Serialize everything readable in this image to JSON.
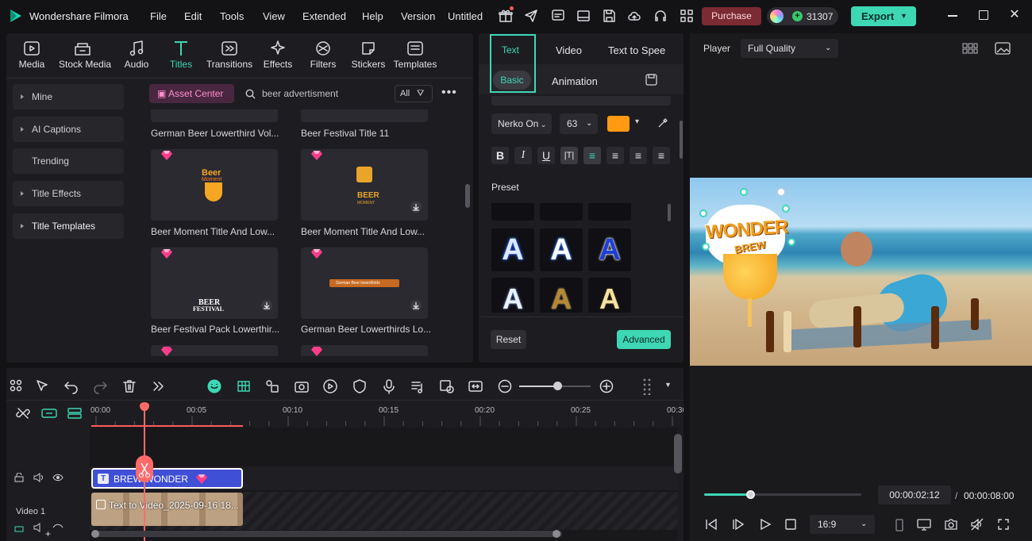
{
  "app": {
    "title": "Wondershare Filmora",
    "project": "Untitled"
  },
  "menu": [
    "File",
    "Edit",
    "Tools",
    "View",
    "Extended",
    "Help",
    "Version"
  ],
  "topbar": {
    "purchase": "Purchase",
    "credits": "31307",
    "export": "Export"
  },
  "categories": [
    "Media",
    "Stock Media",
    "Audio",
    "Titles",
    "Transitions",
    "Effects",
    "Filters",
    "Stickers",
    "Templates"
  ],
  "sidebar": [
    "Mine",
    "AI Captions",
    "Trending",
    "Title Effects",
    "Title Templates"
  ],
  "library": {
    "asset_center": "Asset Center",
    "search_value": "beer advertisment",
    "filter": "All",
    "top_labels": [
      "German Beer Lowerthird Vol...",
      "Beer Festival Title 11"
    ],
    "items": [
      {
        "label": "Beer Moment Title And Low...",
        "thumb_text": [
          "Beer",
          "Moment"
        ]
      },
      {
        "label": "Beer Moment Title And Low...",
        "thumb_text": [
          "BEER",
          "MOMENT"
        ]
      },
      {
        "label": "Beer Festival Pack Lowerthir...",
        "thumb_text": [
          "BEER",
          "FESTIVAL"
        ]
      },
      {
        "label": "German Beer Lowerthirds Lo...",
        "thumb_text": [
          "German Beer lowerthirds"
        ]
      }
    ]
  },
  "props": {
    "tabs": [
      "Text",
      "Video",
      "Text to Spee"
    ],
    "subtabs": [
      "Basic",
      "Animation"
    ],
    "font": "Nerko On",
    "size": "63",
    "color": "#ff9a12",
    "preset_label": "Preset",
    "preset_glyph": "A",
    "reset": "Reset",
    "advanced": "Advanced"
  },
  "player": {
    "label": "Player",
    "quality": "Full Quality",
    "title_text": "WONDER",
    "title_sub": "BREW",
    "current": "00:00:02:12",
    "separator": "/",
    "total": "00:00:08:00",
    "ratio": "16:9",
    "progress": 0.3
  },
  "timeline": {
    "ticks": [
      "00:00",
      "00:05",
      "00:10",
      "00:15",
      "00:20",
      "00:25",
      "00:30"
    ],
    "title_clip": "BREW WONDER",
    "video_clip": "Text to Video_2025-09-16 18...",
    "track_label": "Video 1",
    "playhead_seconds": 2.5
  }
}
